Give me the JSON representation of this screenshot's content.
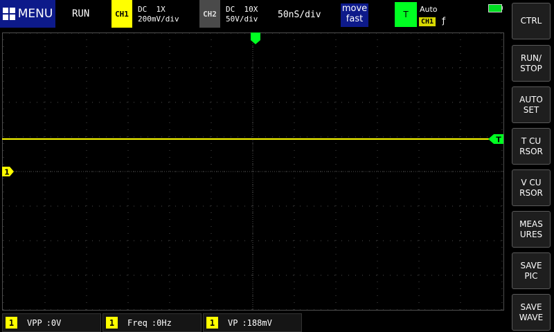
{
  "header": {
    "menu_label": "MENU",
    "run_state": "RUN",
    "ch1": {
      "badge": "CH1",
      "coupling": "DC  1X",
      "scale": "200mV/div"
    },
    "ch2": {
      "badge": "CH2",
      "coupling": "DC  10X",
      "scale": "50V/div"
    },
    "timebase": "50nS/div",
    "move_mode": {
      "line1": "move",
      "line2": "fast"
    },
    "trigger": {
      "badge": "T",
      "mode": "Auto",
      "source": "CH1",
      "edge": "ƒ"
    }
  },
  "screen": {
    "ch1_marker": "1",
    "trigger_marker": "T",
    "colors": {
      "ch1": "#ffff00",
      "trigger": "#00ff22",
      "grid": "#505050"
    }
  },
  "side_buttons": [
    {
      "label": "CTRL"
    },
    {
      "label": "RUN/\nSTOP"
    },
    {
      "label": "AUTO\nSET"
    },
    {
      "label": "T CU\nRSOR"
    },
    {
      "label": "V CU\nRSOR"
    },
    {
      "label": "MEAS\nURES"
    },
    {
      "label": "SAVE\nPIC"
    },
    {
      "label": "SAVE\nWAVE"
    }
  ],
  "measurements": [
    {
      "channel": "1",
      "name": "VPP",
      "value": ":0V"
    },
    {
      "channel": "1",
      "name": "Freq",
      "value": ":0Hz"
    },
    {
      "channel": "1",
      "name": "VP",
      "value": ":188mV"
    }
  ]
}
